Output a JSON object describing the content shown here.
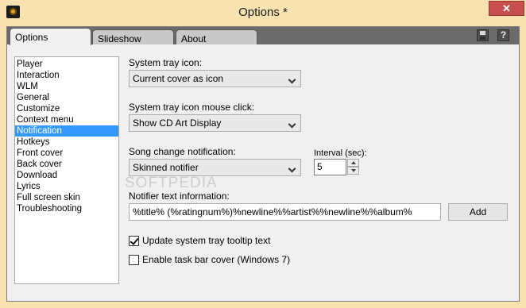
{
  "window": {
    "title": "Options *",
    "minimize_glyph": "",
    "maximize_glyph": "",
    "close_glyph": "✕",
    "icon": "app-icon"
  },
  "tabs": [
    {
      "label": "Options",
      "active": true
    },
    {
      "label": "Slideshow",
      "active": false
    },
    {
      "label": "About",
      "active": false
    }
  ],
  "toolbar": {
    "save_icon": "save-icon",
    "help_icon": "help-icon",
    "help_glyph": "?"
  },
  "nav": {
    "items": [
      "Player",
      "Interaction",
      "WLM",
      "General",
      "Customize",
      "Context menu",
      "Notification",
      "Hotkeys",
      "Front cover",
      "Back cover",
      "Download",
      "Lyrics",
      "Full screen skin",
      "Troubleshooting"
    ],
    "selected_index": 6
  },
  "settings": {
    "tray_icon_label": "System tray icon:",
    "tray_icon_value": "Current cover as icon",
    "tray_click_label": "System tray icon mouse click:",
    "tray_click_value": "Show CD Art Display",
    "song_change_label": "Song change notification:",
    "song_change_value": "Skinned notifier",
    "interval_label": "Interval (sec):",
    "interval_value": "5",
    "notifier_text_label": "Notifier text information:",
    "notifier_text_value": "%title% (%ratingnum%)%newline%%artist%%newline%%album%",
    "add_button": "Add",
    "update_tooltip_label": "Update system tray tooltip text",
    "update_tooltip_checked": true,
    "taskbar_cover_label": "Enable task bar cover (Windows 7)",
    "taskbar_cover_checked": false
  },
  "watermark": "SOFTPEDIA"
}
